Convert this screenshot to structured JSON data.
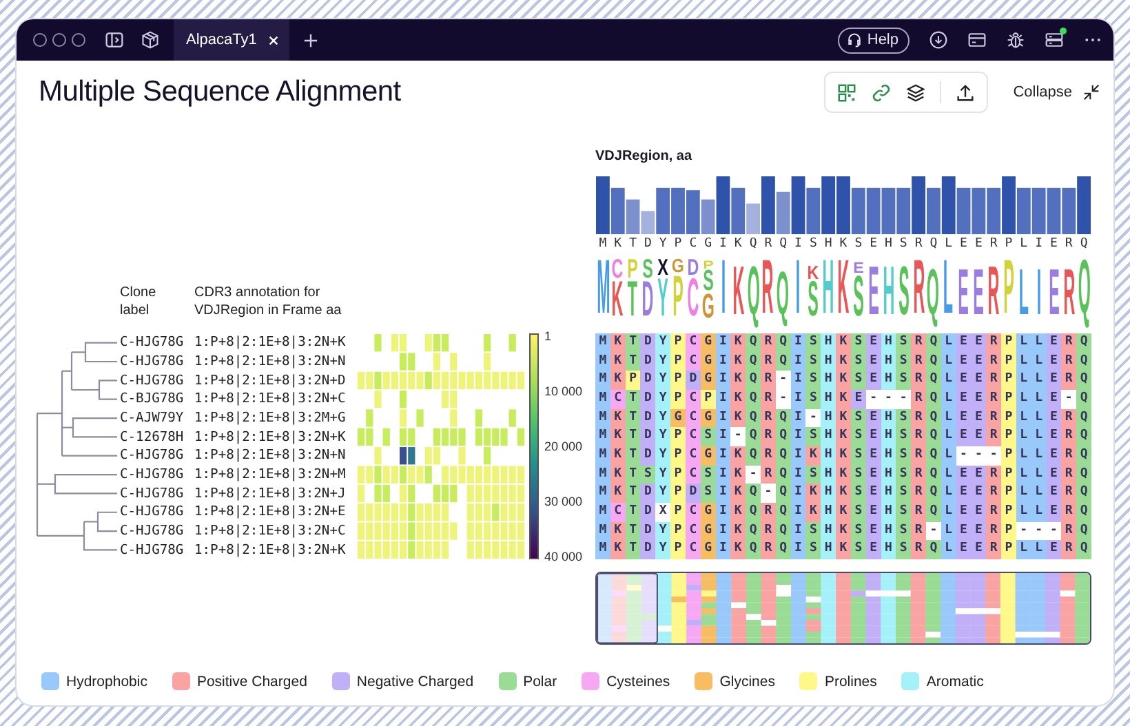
{
  "window": {
    "tab": {
      "label": "AlpacaTy1",
      "selected": true
    },
    "help": "Help",
    "notification": true
  },
  "title": "Multiple Sequence Alignment",
  "collapse": "Collapse",
  "region_title": "VDJRegion, aa",
  "columns": {
    "clone": "Clone label",
    "annotation": "CDR3  annotation for VDJRegion in Frame aa"
  },
  "color_scale": [
    "1",
    "10 000",
    "20 000",
    "30 000",
    "40 000"
  ],
  "consensus": "MKTDYPCGIKQRQISHKSEHSRQLEERPLIERQ",
  "logo": [
    [
      "M"
    ],
    [
      "C",
      "K"
    ],
    [
      "P",
      "T"
    ],
    [
      "S",
      "D"
    ],
    [
      "X",
      "Y"
    ],
    [
      "G",
      "P"
    ],
    [
      "D",
      "C"
    ],
    [
      "P",
      "S",
      "G"
    ],
    [
      "I"
    ],
    [
      "K"
    ],
    [
      "Q"
    ],
    [
      "R"
    ],
    [
      "Q"
    ],
    [
      "I"
    ],
    [
      "K",
      "S"
    ],
    [
      "H"
    ],
    [
      "K"
    ],
    [
      "E",
      "S"
    ],
    [
      "E"
    ],
    [
      "H"
    ],
    [
      "S"
    ],
    [
      "R"
    ],
    [
      "Q"
    ],
    [
      "L"
    ],
    [
      "E"
    ],
    [
      "E"
    ],
    [
      "R"
    ],
    [
      "P"
    ],
    [
      "L"
    ],
    [
      "I"
    ],
    [
      "E"
    ],
    [
      "R"
    ],
    [
      "Q"
    ]
  ],
  "rows": [
    {
      "clone": "C-HJG78G",
      "annotation": "1:P+8|2:1E+8|3:2N+K",
      "sequence": "MKTDYPCGIKQRQISHKSEHSRQLEERPLLERQ"
    },
    {
      "clone": "C-HJG78G",
      "annotation": "1:P+8|2:1E+8|3:2N+N",
      "sequence": "MKTDYPCGIKQRQISHKSEHSRQLEERPLLERQ"
    },
    {
      "clone": "C-HJG78G",
      "annotation": "1:P+8|2:1E+8|3:2N+D",
      "sequence": "MKPDYPDGIKQR-ISHKSEHSRQLEERPLLERQ"
    },
    {
      "clone": "C-BJG78G",
      "annotation": "1:P+8|2:1E+8|3:2N+C",
      "sequence": "MCTDYPCPIKQR-ISHKE---RQLEERPLLE-Q"
    },
    {
      "clone": "C-AJW79Y",
      "annotation": "1:P+8|2:1E+8|3:2M+G",
      "sequence": "MKTDYGCGIKQRQI-HKSEHSRQLEERPLLERQ"
    },
    {
      "clone": "C-12678H",
      "annotation": "1:P+8|2:1E+8|3:2N+K",
      "sequence": "MKTDYPCSI-QRQISHKSEHSRQLEERPLLERQ"
    },
    {
      "clone": "C-HJG78G",
      "annotation": "1:P+8|2:1E+8|3:2N+N",
      "sequence": "MKTDYPCGIKQRQIKHKSEHSRQL---PLLERQ"
    },
    {
      "clone": "C-HJG78G",
      "annotation": "1:P+8|2:1E+8|3:2N+M",
      "sequence": "MKTSYPCSIK-RQISHKSEHSRQLEERPLLERQ"
    },
    {
      "clone": "C-HJG78G",
      "annotation": "1:P+8|2:1E+8|3:2N+J",
      "sequence": "MKTDYPDSIKQ-QIKHKSEHSRQLEERPLLERQ"
    },
    {
      "clone": "C-HJG78G",
      "annotation": "1:P+8|2:1E+8|3:2N+E",
      "sequence": "MCTDXPCGIKQRQIKHKSEHSRQLEERPLLERQ"
    },
    {
      "clone": "C-HJG78G",
      "annotation": "1:P+8|2:1E+8|3:2N+C",
      "sequence": "MKTDYPCGIKQRQISHKSEHSR-LEERP---RQ"
    },
    {
      "clone": "C-HJG78G",
      "annotation": "1:P+8|2:1E+8|3:2N+K",
      "sequence": "MKTDYPCGIKQRQISHKSEHSRQLEERPLLERQ"
    }
  ],
  "legend": [
    {
      "label": "Hydrophobic",
      "color": "#99c8fb"
    },
    {
      "label": "Positive Charged",
      "color": "#f9a3a3"
    },
    {
      "label": "Negative Charged",
      "color": "#c1b0f8"
    },
    {
      "label": "Polar",
      "color": "#9adc95"
    },
    {
      "label": "Cysteines",
      "color": "#f6a8f3"
    },
    {
      "label": "Glycines",
      "color": "#f6bd62"
    },
    {
      "label": "Prolines",
      "color": "#fdf889"
    },
    {
      "label": "Aromatic",
      "color": "#a5f1f9"
    }
  ]
}
